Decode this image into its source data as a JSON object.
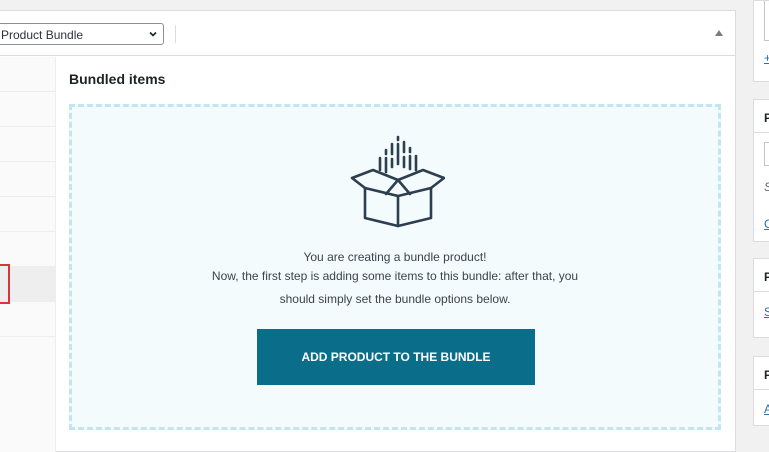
{
  "product_data": {
    "type_select_value": "Product Bundle",
    "section_title": "Bundled items"
  },
  "bundle_empty_state": {
    "message_line1": "You are creating a bundle product!",
    "message_line2": "Now, the first step is adding some items to this bundle: after that, you",
    "message_line3": "should simply set the bundle options below.",
    "add_button_label": "ADD PRODUCT TO THE BUNDLE"
  },
  "sidebar_fragments": {
    "box1_link": "+",
    "box2_title": "P",
    "box2_italic": "S",
    "box2_link": "C",
    "box3_title": "P",
    "box3_link": "S",
    "box4_title": "P",
    "box4_link": "A"
  },
  "colors": {
    "accent_button": "#0a6d8a",
    "dropzone_bg": "#f3fbfd",
    "dropzone_border": "#c2e6ef",
    "highlight_marker": "#d63638"
  },
  "icons": {
    "select_chevron": "chevron-down-icon",
    "panel_toggle": "caret-up-icon",
    "empty_state": "open-box-icon"
  }
}
